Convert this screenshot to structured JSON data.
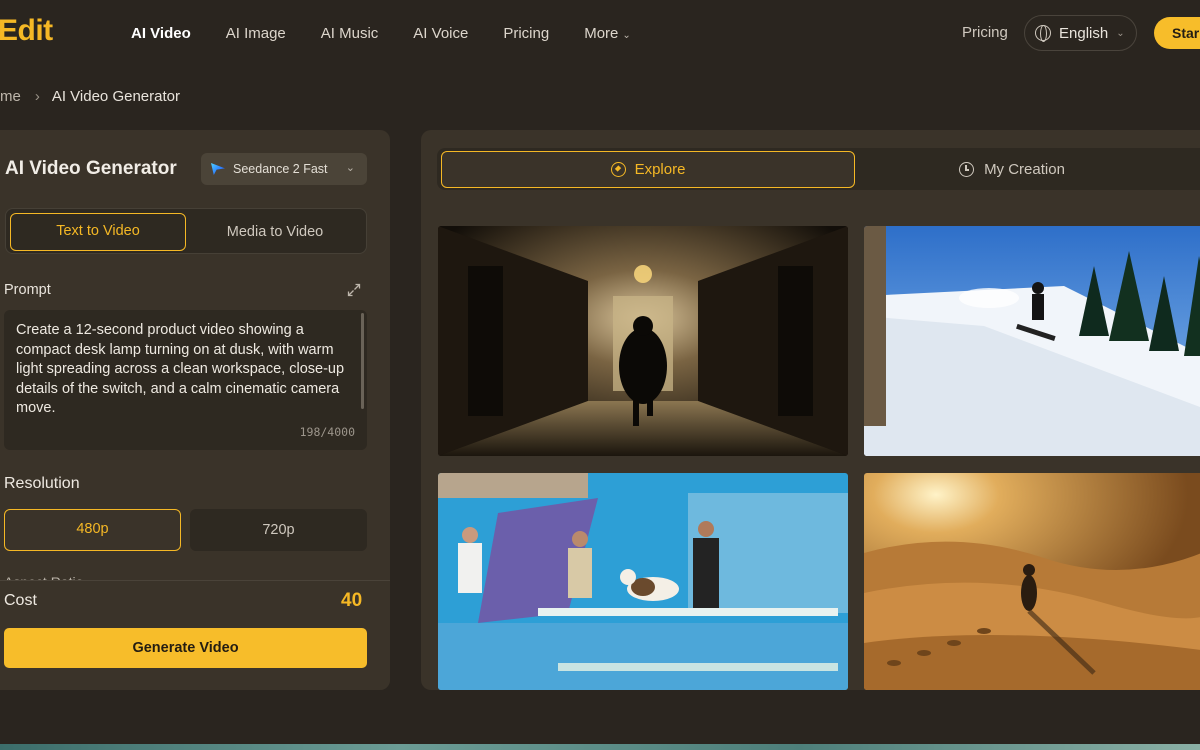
{
  "brand": {
    "logo_text": "Edit",
    "accent": "#f5b825"
  },
  "nav": {
    "links": [
      "AI Video",
      "AI Image",
      "AI Music",
      "AI Voice",
      "Pricing",
      "More"
    ],
    "pricing": "Pricing",
    "language": "English",
    "start": "Star"
  },
  "breadcrumb": {
    "home": "me",
    "current": "AI Video Generator"
  },
  "generator": {
    "title": "AI Video Generator",
    "model": "Seedance 2 Fast",
    "tabs": [
      "Text to Video",
      "Media to Video"
    ],
    "prompt_label": "Prompt",
    "prompt_text": "Create a 12-second product video showing a compact desk lamp turning on at dusk, with warm light spreading across a clean workspace, close-up details of the switch, and a calm cinematic camera move.",
    "char_count": "198/4000",
    "resolution_label": "Resolution",
    "resolutions": [
      "480p",
      "720p"
    ],
    "selected_resolution": "480p",
    "aspect_label": "Aspect Ratio",
    "cost_label": "Cost",
    "cost_value": "40",
    "generate_label": "Generate Video"
  },
  "gallery": {
    "tabs": [
      "Explore",
      "My Creation"
    ],
    "active_tab": "Explore",
    "items": [
      {
        "scene": "hallway-runner"
      },
      {
        "scene": "snowboarder"
      },
      {
        "scene": "cat-diving-board"
      },
      {
        "scene": "desert-walker"
      }
    ]
  }
}
